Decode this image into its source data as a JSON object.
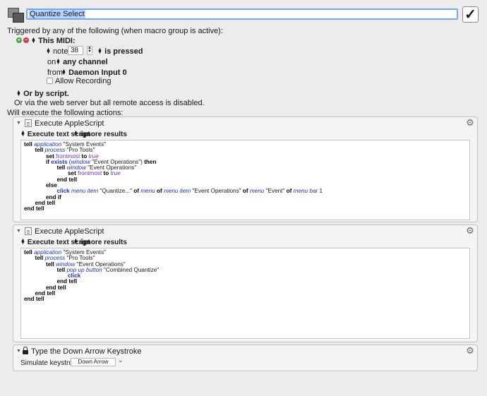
{
  "macro": {
    "title": "Quantize Select",
    "enabled_checkmark": "✓"
  },
  "triggers": {
    "heading": "Triggered by any of the following (when macro group is active):",
    "midi_label": "This MIDI:",
    "note_label": "note",
    "note_value": "38",
    "pressed_label": "is pressed",
    "on_label": "on",
    "channel_label": "any channel",
    "from_label": "from",
    "source_label": "Daemon Input 0",
    "allow_recording": "Allow Recording",
    "or_script": "Or by script.",
    "web_server": "Or via the web server but all remote access is disabled."
  },
  "actions_heading": "Will execute the following actions:",
  "actions": [
    {
      "title": "Execute AppleScript",
      "option_1": "Execute text script",
      "option_2": "ignore results",
      "code_lines": [
        {
          "indent": 0,
          "parts": [
            [
              "kw",
              "tell "
            ],
            [
              "cls",
              "application"
            ],
            [
              "t",
              " \"System Events\""
            ]
          ]
        },
        {
          "indent": 1,
          "parts": [
            [
              "kw",
              "tell "
            ],
            [
              "cls",
              "process"
            ],
            [
              "t",
              " \"Pro Tools\""
            ]
          ]
        },
        {
          "indent": 2,
          "parts": [
            [
              "kw",
              "set "
            ],
            [
              "prop",
              "frontmost"
            ],
            [
              "kw",
              " to "
            ],
            [
              "con",
              "true"
            ]
          ]
        },
        {
          "indent": 2,
          "parts": [
            [
              "kw",
              "if "
            ],
            [
              "cmd",
              "exists"
            ],
            [
              "t",
              " ("
            ],
            [
              "cls",
              "window"
            ],
            [
              "t",
              " \"Event Operations\") "
            ],
            [
              "kw",
              "then"
            ]
          ]
        },
        {
          "indent": 3,
          "parts": [
            [
              "kw",
              "tell "
            ],
            [
              "cls",
              "window"
            ],
            [
              "t",
              " \"Event Operations\""
            ]
          ]
        },
        {
          "indent": 4,
          "parts": [
            [
              "kw",
              "set "
            ],
            [
              "prop",
              "frontmost"
            ],
            [
              "kw",
              " to "
            ],
            [
              "con",
              "true"
            ]
          ]
        },
        {
          "indent": 3,
          "parts": [
            [
              "kw",
              "end tell"
            ]
          ]
        },
        {
          "indent": 2,
          "parts": [
            [
              "kw",
              "else"
            ]
          ]
        },
        {
          "indent": 3,
          "parts": [
            [
              "cmd",
              "click "
            ],
            [
              "cls",
              "menu item"
            ],
            [
              "t",
              " \"Quantize...\" "
            ],
            [
              "kw",
              "of "
            ],
            [
              "cls",
              "menu"
            ],
            [
              "kw",
              " of "
            ],
            [
              "cls",
              "menu item"
            ],
            [
              "t",
              " \"Event Operations\" "
            ],
            [
              "kw",
              "of "
            ],
            [
              "cls",
              "menu"
            ],
            [
              "t",
              " \"Event\" "
            ],
            [
              "kw",
              "of "
            ],
            [
              "cls",
              "menu bar"
            ],
            [
              "t",
              " 1"
            ]
          ]
        },
        {
          "indent": 2,
          "parts": [
            [
              "kw",
              "end if"
            ]
          ]
        },
        {
          "indent": 1,
          "parts": [
            [
              "kw",
              "end tell"
            ]
          ]
        },
        {
          "indent": 0,
          "parts": [
            [
              "kw",
              "end tell"
            ]
          ]
        }
      ]
    },
    {
      "title": "Execute AppleScript",
      "option_1": "Execute text script",
      "option_2": "ignore results",
      "code_lines": [
        {
          "indent": 0,
          "parts": [
            [
              "kw",
              "tell "
            ],
            [
              "cls",
              "application"
            ],
            [
              "t",
              " \"System Events\""
            ]
          ]
        },
        {
          "indent": 1,
          "parts": [
            [
              "kw",
              "tell "
            ],
            [
              "cls",
              "process"
            ],
            [
              "t",
              " \"Pro Tools\""
            ]
          ]
        },
        {
          "indent": 2,
          "parts": [
            [
              "kw",
              "tell "
            ],
            [
              "cls",
              "window"
            ],
            [
              "t",
              " \"Event Operations\""
            ]
          ]
        },
        {
          "indent": 3,
          "parts": [
            [
              "kw",
              "tell "
            ],
            [
              "cls",
              "pop up button"
            ],
            [
              "t",
              " \"Combined Quantize\""
            ]
          ]
        },
        {
          "indent": 4,
          "parts": [
            [
              "cmd",
              "click"
            ]
          ]
        },
        {
          "indent": 3,
          "parts": [
            [
              "kw",
              "end tell"
            ]
          ]
        },
        {
          "indent": 2,
          "parts": [
            [
              "kw",
              "end tell"
            ]
          ]
        },
        {
          "indent": 1,
          "parts": [
            [
              "kw",
              "end tell"
            ]
          ]
        },
        {
          "indent": 0,
          "parts": [
            [
              "kw",
              "end tell"
            ]
          ]
        }
      ]
    }
  ],
  "keystroke_action": {
    "title": "Type the Down Arrow Keystroke",
    "simulate_label": "Simulate keystroke:",
    "key_value": "Down Arrow"
  },
  "icons": {
    "disclosure": "▼",
    "gear": "⚙",
    "lock": "lock-icon",
    "chevron_down": "⌄"
  }
}
